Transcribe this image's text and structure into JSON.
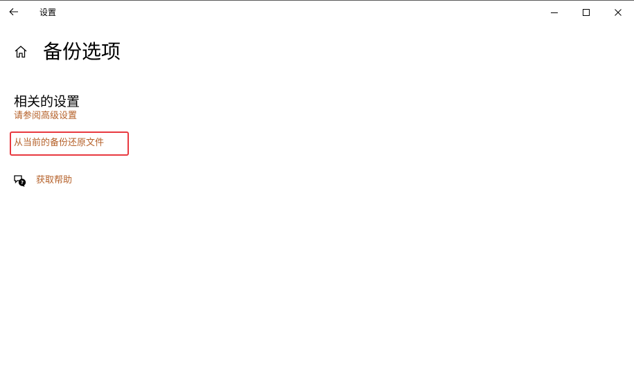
{
  "window": {
    "title": "设置"
  },
  "icons": {
    "back": "arrow-left-icon",
    "minimize": "minimize-icon",
    "maximize": "maximize-icon",
    "close": "close-icon",
    "home": "home-icon",
    "help": "chat-help-icon"
  },
  "page": {
    "title": "备份选项"
  },
  "related": {
    "heading": "相关的设置",
    "advanced_link": "请参阅高级设置",
    "restore_link": "从当前的备份还原文件"
  },
  "help": {
    "label": "获取帮助"
  },
  "colors": {
    "link": "#b5612a",
    "highlight": "#e8383f"
  }
}
